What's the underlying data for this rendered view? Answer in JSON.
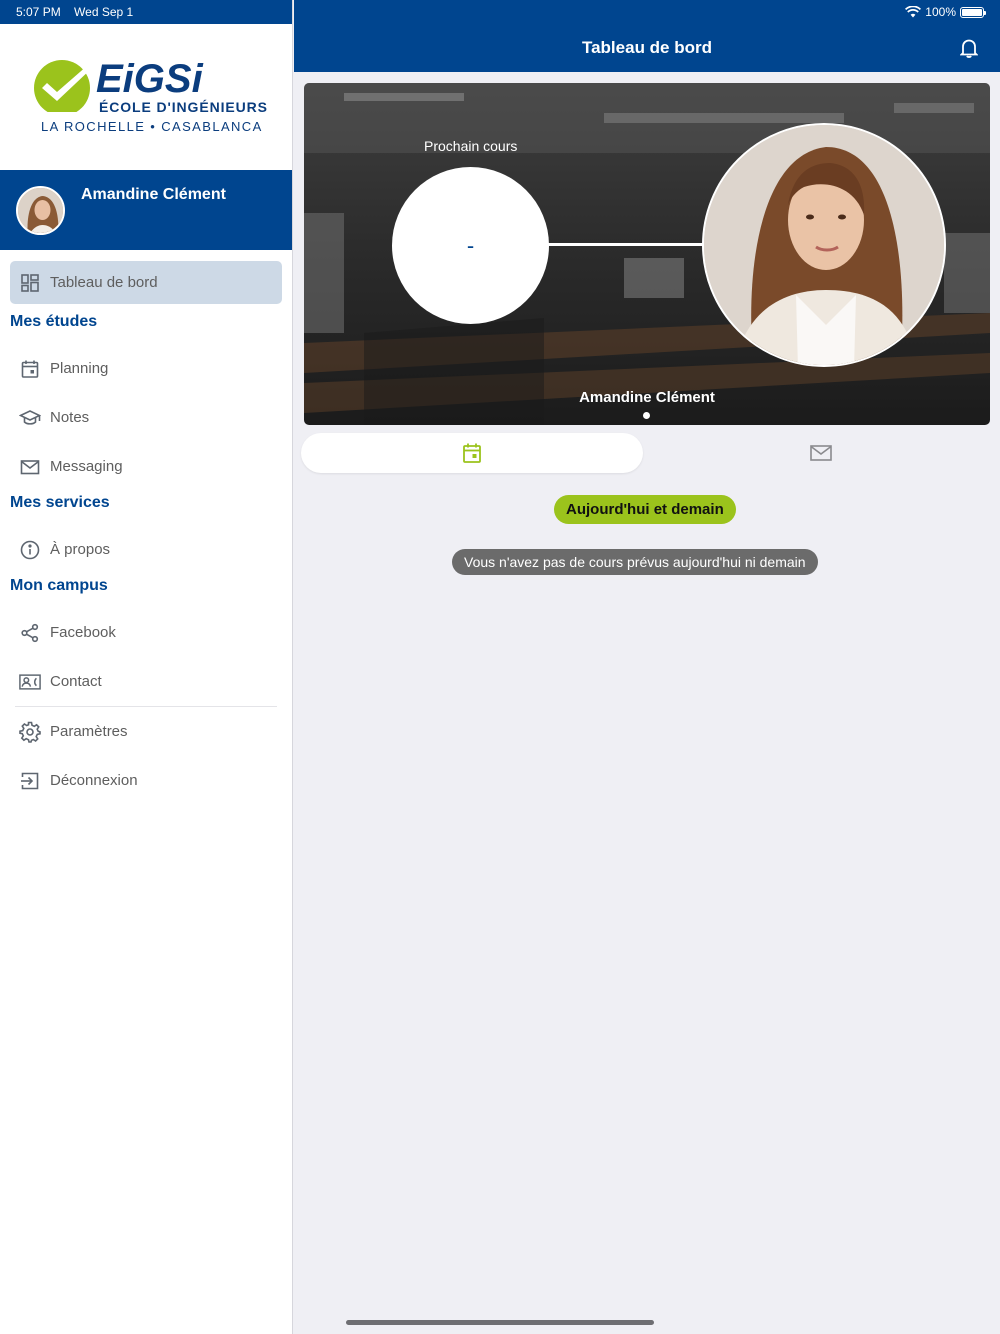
{
  "status": {
    "time": "5:07 PM",
    "date": "Wed Sep 1",
    "battery": "100%"
  },
  "logo": {
    "brand": "EIGSI",
    "line1": "ÉCOLE D'INGÉNIEURS",
    "line2": "LA ROCHELLE • CASABLANCA"
  },
  "profile": {
    "name": "Amandine Clément"
  },
  "menu": {
    "dashboard": "Tableau de bord",
    "section_studies": "Mes études",
    "planning": "Planning",
    "notes": "Notes",
    "messaging": "Messaging",
    "section_services": "Mes services",
    "about": "À propos",
    "section_campus": "Mon campus",
    "facebook": "Facebook",
    "contact": "Contact",
    "settings": "Paramètres",
    "logout": "Déconnexion"
  },
  "header": {
    "title": "Tableau de bord"
  },
  "hero": {
    "label": "Prochain cours",
    "next_course": "-",
    "name": "Amandine Clément"
  },
  "filter_chip": "Aujourd'hui et demain",
  "empty_message": "Vous n'avez pas de cours prévus aujourd'hui ni demain",
  "colors": {
    "primary": "#00458f",
    "accent_green": "#9bc31c",
    "active_item": "#cdd9e6"
  }
}
